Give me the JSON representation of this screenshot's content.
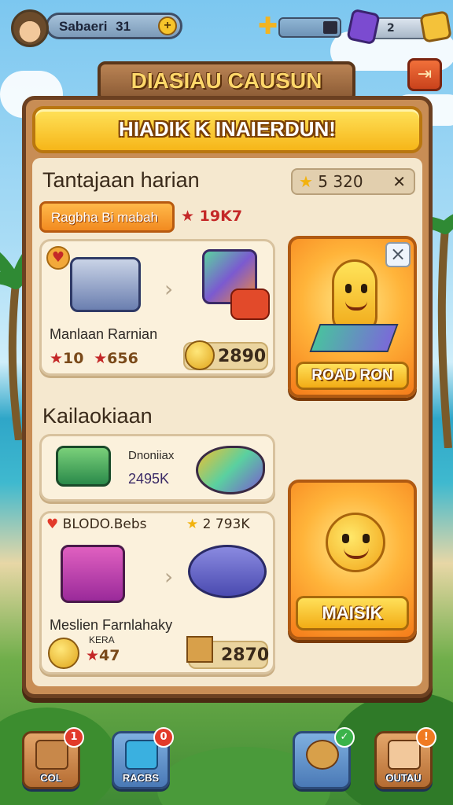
{
  "player": {
    "name": "Sabaeri",
    "level": "31",
    "add_label": "+"
  },
  "resources": {
    "energy_value": "",
    "gems_value": "2"
  },
  "header": {
    "title": "DIASIAU CAUSUN",
    "close_label": "⇥"
  },
  "subbanner": {
    "text": "HIADIK K INAIERDUN!"
  },
  "daily": {
    "title": "Tantajaan harian",
    "stars": "5 320",
    "close_label": "✕",
    "tab_label": "Ragbha Bi mabah",
    "tab_value": "19K7",
    "card1": {
      "label": "Manlaan Rarnian",
      "cost_a": "10",
      "cost_b": "656",
      "reward": "2890"
    },
    "feature1_label": "ROAD RON"
  },
  "section2": {
    "title": "Kailaokiaan",
    "card2": {
      "title": "Dnoniiax",
      "value": "2495K"
    },
    "card3": {
      "badge_text": "BLODO.Bebs",
      "stars_value": "2 793K",
      "label_line1": "Meslien Farnlahaky",
      "label_line2": "KERA",
      "cost": "47",
      "reward": "2870"
    },
    "feature2_label": "MAISIK"
  },
  "nav": [
    {
      "label": "COL",
      "badge": "1",
      "badge_color": "red"
    },
    {
      "label": "RACBS",
      "badge": "0",
      "badge_color": "red"
    },
    {
      "label": "",
      "badge": "✓",
      "badge_color": "green"
    },
    {
      "label": "OUTAU",
      "badge": "!",
      "badge_color": "orange"
    }
  ],
  "colors": {
    "panel": "#c88d55",
    "panel_inner": "#f5e8cf",
    "accent_yellow": "#ffd23a",
    "accent_orange": "#f28a20",
    "star_red": "#c42828"
  }
}
